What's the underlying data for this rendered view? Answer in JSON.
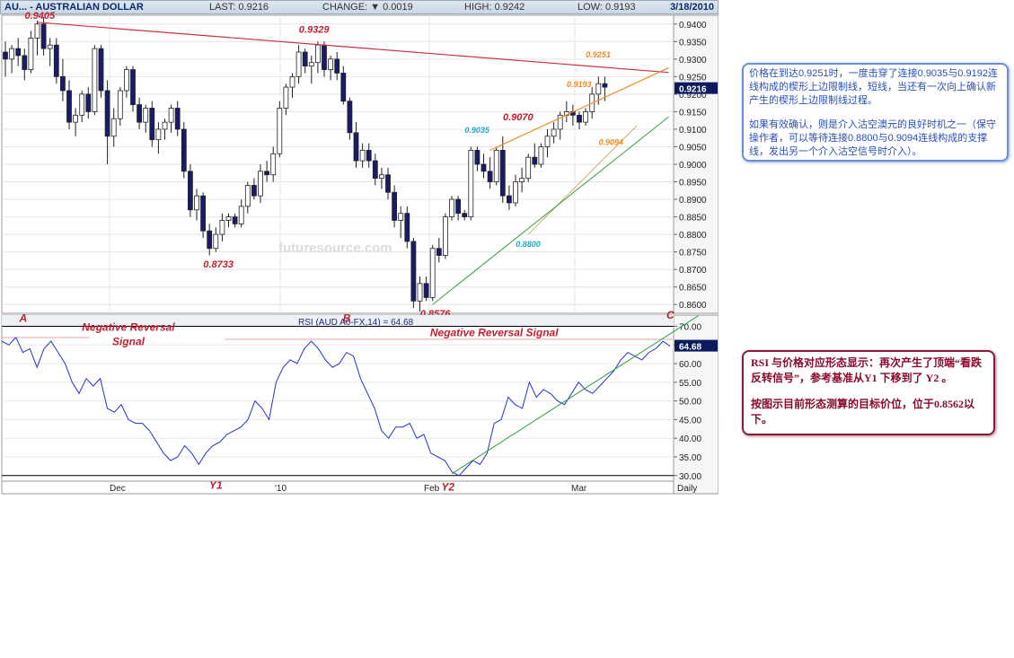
{
  "header": {
    "symbol": "AU... - AUSTRALIAN DOLLAR",
    "last": "LAST: 0.9216",
    "change": "CHANGE: ▼ 0.0019",
    "high": "HIGH: 0.9242",
    "low": "LOW: 0.9193",
    "date": "3/18/2010"
  },
  "colors": {
    "up_candle": "#ffffff",
    "down_candle": "#1a1a6a",
    "upper_trend": "#d03040",
    "wedge_upper": "#f08a20",
    "support": "#30a040",
    "rsi_line": "#2233cc",
    "label_red": "#c02030",
    "label_cyan": "#20a8c8"
  },
  "chart_data": [
    {
      "type": "candlestick",
      "title": "",
      "y_ticks": [
        "0.9400",
        "0.9350",
        "0.9300",
        "0.9250",
        "0.9200",
        "0.9150",
        "0.9100",
        "0.9050",
        "0.9000",
        "0.8950",
        "0.8900",
        "0.8850",
        "0.8800",
        "0.8750",
        "0.8700",
        "0.8650",
        "0.8600"
      ],
      "ylim": [
        0.8575,
        0.9425
      ],
      "last_price_label": "0.9216",
      "watermark": "futuresource.com",
      "candles": [
        [
          0.932,
          0.935,
          0.925,
          0.93
        ],
        [
          0.93,
          0.934,
          0.926,
          0.933
        ],
        [
          0.933,
          0.936,
          0.928,
          0.931
        ],
        [
          0.931,
          0.933,
          0.924,
          0.927
        ],
        [
          0.927,
          0.938,
          0.926,
          0.936
        ],
        [
          0.936,
          0.941,
          0.931,
          0.94
        ],
        [
          0.94,
          0.942,
          0.931,
          0.933
        ],
        [
          0.933,
          0.936,
          0.928,
          0.934
        ],
        [
          0.934,
          0.936,
          0.923,
          0.925
        ],
        [
          0.925,
          0.93,
          0.918,
          0.921
        ],
        [
          0.921,
          0.924,
          0.91,
          0.912
        ],
        [
          0.912,
          0.916,
          0.908,
          0.914
        ],
        [
          0.914,
          0.921,
          0.912,
          0.92
        ],
        [
          0.92,
          0.922,
          0.913,
          0.915
        ],
        [
          0.915,
          0.934,
          0.914,
          0.933
        ],
        [
          0.933,
          0.934,
          0.919,
          0.921
        ],
        [
          0.921,
          0.924,
          0.9,
          0.908
        ],
        [
          0.908,
          0.916,
          0.905,
          0.913
        ],
        [
          0.913,
          0.922,
          0.911,
          0.921
        ],
        [
          0.921,
          0.928,
          0.919,
          0.927
        ],
        [
          0.927,
          0.928,
          0.915,
          0.917
        ],
        [
          0.917,
          0.919,
          0.91,
          0.912
        ],
        [
          0.912,
          0.917,
          0.909,
          0.916
        ],
        [
          0.916,
          0.918,
          0.905,
          0.907
        ],
        [
          0.907,
          0.912,
          0.903,
          0.91
        ],
        [
          0.91,
          0.913,
          0.907,
          0.912
        ],
        [
          0.912,
          0.917,
          0.909,
          0.916
        ],
        [
          0.916,
          0.918,
          0.908,
          0.91
        ],
        [
          0.91,
          0.912,
          0.896,
          0.898
        ],
        [
          0.898,
          0.9,
          0.885,
          0.887
        ],
        [
          0.887,
          0.893,
          0.884,
          0.891
        ],
        [
          0.891,
          0.892,
          0.879,
          0.881
        ],
        [
          0.881,
          0.883,
          0.874,
          0.876
        ],
        [
          0.876,
          0.882,
          0.875,
          0.88
        ],
        [
          0.88,
          0.886,
          0.878,
          0.884
        ],
        [
          0.884,
          0.886,
          0.882,
          0.885
        ],
        [
          0.885,
          0.886,
          0.882,
          0.883
        ],
        [
          0.883,
          0.89,
          0.882,
          0.888
        ],
        [
          0.888,
          0.895,
          0.886,
          0.894
        ],
        [
          0.894,
          0.896,
          0.89,
          0.891
        ],
        [
          0.891,
          0.9,
          0.889,
          0.898
        ],
        [
          0.898,
          0.901,
          0.895,
          0.897
        ],
        [
          0.897,
          0.905,
          0.895,
          0.903
        ],
        [
          0.903,
          0.918,
          0.902,
          0.916
        ],
        [
          0.916,
          0.923,
          0.914,
          0.922
        ],
        [
          0.922,
          0.926,
          0.919,
          0.925
        ],
        [
          0.925,
          0.934,
          0.923,
          0.932
        ],
        [
          0.932,
          0.933,
          0.926,
          0.928
        ],
        [
          0.928,
          0.931,
          0.923,
          0.929
        ],
        [
          0.929,
          0.935,
          0.926,
          0.934
        ],
        [
          0.934,
          0.935,
          0.925,
          0.927
        ],
        [
          0.927,
          0.931,
          0.924,
          0.93
        ],
        [
          0.93,
          0.932,
          0.924,
          0.926
        ],
        [
          0.926,
          0.928,
          0.917,
          0.918
        ],
        [
          0.918,
          0.919,
          0.907,
          0.909
        ],
        [
          0.909,
          0.912,
          0.899,
          0.901
        ],
        [
          0.901,
          0.906,
          0.899,
          0.904
        ],
        [
          0.904,
          0.906,
          0.899,
          0.901
        ],
        [
          0.901,
          0.903,
          0.894,
          0.896
        ],
        [
          0.896,
          0.899,
          0.893,
          0.897
        ],
        [
          0.897,
          0.899,
          0.89,
          0.892
        ],
        [
          0.892,
          0.894,
          0.882,
          0.884
        ],
        [
          0.884,
          0.888,
          0.879,
          0.886
        ],
        [
          0.886,
          0.888,
          0.876,
          0.878
        ],
        [
          0.878,
          0.879,
          0.859,
          0.861
        ],
        [
          0.861,
          0.868,
          0.858,
          0.866
        ],
        [
          0.866,
          0.868,
          0.861,
          0.862
        ],
        [
          0.862,
          0.877,
          0.861,
          0.876
        ],
        [
          0.876,
          0.879,
          0.872,
          0.874
        ],
        [
          0.874,
          0.886,
          0.873,
          0.885
        ],
        [
          0.885,
          0.891,
          0.884,
          0.89
        ],
        [
          0.89,
          0.891,
          0.884,
          0.886
        ],
        [
          0.886,
          0.887,
          0.884,
          0.885
        ],
        [
          0.885,
          0.905,
          0.884,
          0.904
        ],
        [
          0.904,
          0.905,
          0.898,
          0.9
        ],
        [
          0.9,
          0.903,
          0.896,
          0.898
        ],
        [
          0.898,
          0.902,
          0.893,
          0.895
        ],
        [
          0.895,
          0.905,
          0.894,
          0.904
        ],
        [
          0.904,
          0.908,
          0.889,
          0.891
        ],
        [
          0.891,
          0.894,
          0.887,
          0.889
        ],
        [
          0.889,
          0.897,
          0.888,
          0.895
        ],
        [
          0.895,
          0.899,
          0.892,
          0.896
        ],
        [
          0.896,
          0.903,
          0.895,
          0.902
        ],
        [
          0.902,
          0.906,
          0.899,
          0.9
        ],
        [
          0.9,
          0.906,
          0.899,
          0.905
        ],
        [
          0.905,
          0.91,
          0.902,
          0.908
        ],
        [
          0.908,
          0.912,
          0.906,
          0.91
        ],
        [
          0.91,
          0.915,
          0.907,
          0.914
        ],
        [
          0.914,
          0.918,
          0.912,
          0.915
        ],
        [
          0.915,
          0.917,
          0.911,
          0.914
        ],
        [
          0.914,
          0.915,
          0.91,
          0.912
        ],
        [
          0.912,
          0.916,
          0.911,
          0.915
        ],
        [
          0.915,
          0.922,
          0.913,
          0.92
        ],
        [
          0.92,
          0.925,
          0.917,
          0.923
        ],
        [
          0.923,
          0.925,
          0.918,
          0.922
        ]
      ],
      "annotations": [
        {
          "text": "0.9405",
          "color": "red",
          "i": 5,
          "price": 0.9415
        },
        {
          "text": "0.9329",
          "color": "red",
          "i": 48,
          "price": 0.9375
        },
        {
          "text": "0.8733",
          "color": "red",
          "i": 33,
          "price": 0.8705
        },
        {
          "text": "0.8576",
          "color": "red",
          "i": 67,
          "price": 0.8565
        },
        {
          "text": "0.9070",
          "color": "red",
          "i": 80,
          "price": 0.9125
        },
        {
          "text": "0.9035",
          "color": "cyan",
          "i": 74,
          "price": 0.909
        },
        {
          "text": "0.8800",
          "color": "cyan",
          "i": 82,
          "price": 0.8765
        },
        {
          "text": "0.9251",
          "color": "orange",
          "i": 93,
          "price": 0.9305
        },
        {
          "text": "0.9193",
          "color": "orange",
          "i": 90,
          "price": 0.922
        },
        {
          "text": "0.9094",
          "color": "orange",
          "i": 95,
          "price": 0.9055
        }
      ],
      "lines": [
        {
          "kind": "upper_trend",
          "from": {
            "i": 5,
            "price": 0.9405
          },
          "to": {
            "i": 104,
            "price": 0.9262
          }
        },
        {
          "kind": "wedge_upper",
          "from": {
            "i": 76,
            "price": 0.904
          },
          "to": {
            "i": 104,
            "price": 0.9275
          }
        },
        {
          "kind": "wedge_lower",
          "from": {
            "i": 82,
            "price": 0.88
          },
          "to": {
            "i": 99,
            "price": 0.911
          }
        },
        {
          "kind": "support",
          "from": {
            "i": 67,
            "price": 0.86
          },
          "to": {
            "i": 104,
            "price": 0.9135
          }
        }
      ]
    },
    {
      "type": "line",
      "title": "RSI (AUD A0-FX,14) = 64.68",
      "y_ticks": [
        "70.00",
        "65.00",
        "60.00",
        "55.00",
        "50.00",
        "45.00",
        "40.00",
        "35.00",
        "30.00"
      ],
      "ylim": [
        28.5,
        73.0
      ],
      "last_value_label": "64.68",
      "x_tick_labels": [
        "Dec",
        "'10",
        "Feb",
        "Mar",
        "Daily"
      ],
      "values": [
        66,
        65,
        67,
        63,
        64,
        59,
        64,
        66,
        63,
        60,
        55,
        52,
        56,
        54,
        56,
        48,
        47,
        49,
        45,
        44,
        44,
        42,
        39,
        36,
        34,
        35,
        38,
        36,
        33,
        36,
        38,
        39,
        41,
        42,
        43,
        45,
        50,
        48,
        45,
        55,
        59,
        61,
        60,
        64,
        66,
        64,
        61,
        59,
        60,
        63,
        62,
        56,
        52,
        48,
        42,
        40,
        43,
        43,
        44,
        40,
        41,
        36,
        35,
        34,
        31,
        30,
        32,
        34,
        33,
        36,
        44,
        45,
        51,
        49,
        48,
        55,
        51,
        53,
        52,
        50,
        49,
        52,
        55,
        53,
        52,
        54,
        56,
        58,
        61,
        63,
        62,
        61,
        63,
        64,
        66,
        64.68
      ],
      "labels": [
        {
          "text": "A",
          "i": 3,
          "v": 71.2
        },
        {
          "text": "B",
          "i": 49,
          "v": 71.2
        },
        {
          "text": "C",
          "i": 95,
          "v": 72.0
        },
        {
          "text": "Y1",
          "i": 30,
          "v": 26.5
        },
        {
          "text": "Y2",
          "i": 63,
          "v": 26.0
        }
      ],
      "signals": [
        {
          "text": "Negative Reversal",
          "i": 18,
          "v": 68.8
        },
        {
          "text": "Signal",
          "i": 18,
          "v": 65.0
        },
        {
          "text": "Negative Reversal Signal",
          "i": 70,
          "v": 67.3
        }
      ],
      "lines": [
        {
          "kind": "support",
          "from": {
            "i": 64,
            "v": 30.5
          },
          "to": {
            "i": 99,
            "v": 72.8
          }
        }
      ]
    }
  ],
  "notes": {
    "note1_p1": "价格在到达0.9251时，一度击穿了连接0.9035与0.9192连线构成的楔形上边限制线，短线，当还有一次向上确认新产生的楔形上边限制线过程。",
    "note1_p2": "如果有效确认，则是介入沽空澳元的良好时机之一（保守操作者，可以等待连接0.8800与0.9094连线构成的支撑线，发出另一个介入沽空信号时介入）。",
    "note2_p1": "RSI 与价格对应形态显示：再次产生了顶端“看跌反转信号”，参考基准从Y1 下移到了 Y2 。",
    "note2_p2": "按图示目前形态测算的目标价位，位于0.8562以下。"
  }
}
